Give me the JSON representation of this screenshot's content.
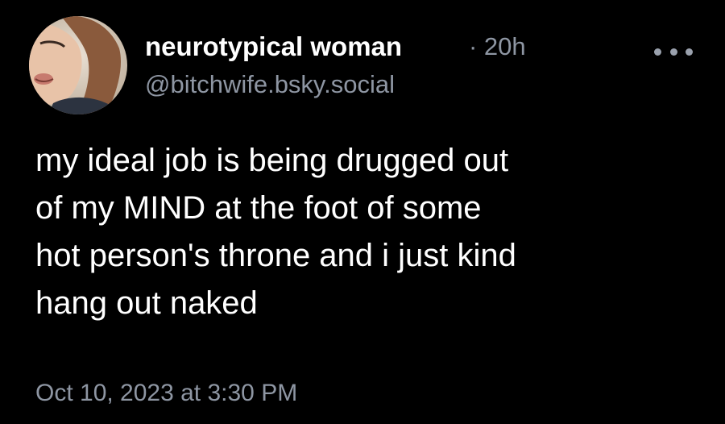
{
  "post": {
    "author": {
      "display_name": "neurotypical woman",
      "handle": "@bitchwife.bsky.social",
      "avatar_icon": "user-photo-avatar"
    },
    "relative_time": "· 20h",
    "more_icon": "more-horizontal-icon",
    "text_lines": [
      "my ideal job is being drugged out",
      "of my MIND at the foot of some",
      "hot person's throne and i just kind",
      "hang out naked"
    ],
    "date": "Oct 10, 2023 at 3:30 PM"
  },
  "colors": {
    "background": "#000000",
    "primary_text": "#ffffff",
    "secondary_text": "#8e96a3"
  }
}
